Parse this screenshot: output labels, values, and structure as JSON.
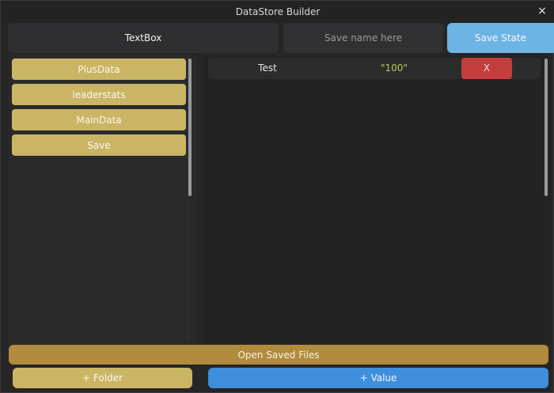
{
  "window": {
    "title": "DataStore Builder",
    "close_glyph": "×"
  },
  "top": {
    "textbox_label": "TextBox",
    "save_name_placeholder": "Save name here",
    "save_state_label": "Save State"
  },
  "folders": {
    "items": [
      {
        "label": "PlusData"
      },
      {
        "label": "leaderstats"
      },
      {
        "label": "MainData"
      },
      {
        "label": "Save"
      }
    ]
  },
  "values": {
    "rows": [
      {
        "key": "Test",
        "value": "\"100\"",
        "delete_label": "X"
      }
    ]
  },
  "bottom": {
    "open_saved_label": "Open Saved Files",
    "add_folder_label": "+ Folder",
    "add_value_label": "+ Value"
  },
  "colors": {
    "folder_gold": "#cab565",
    "open_saved_gold": "#b18b3e",
    "save_state_blue": "#6cb4e4",
    "add_value_blue": "#3f8fdc",
    "delete_red": "#c23e3e",
    "value_text_green": "#b4c95a"
  }
}
